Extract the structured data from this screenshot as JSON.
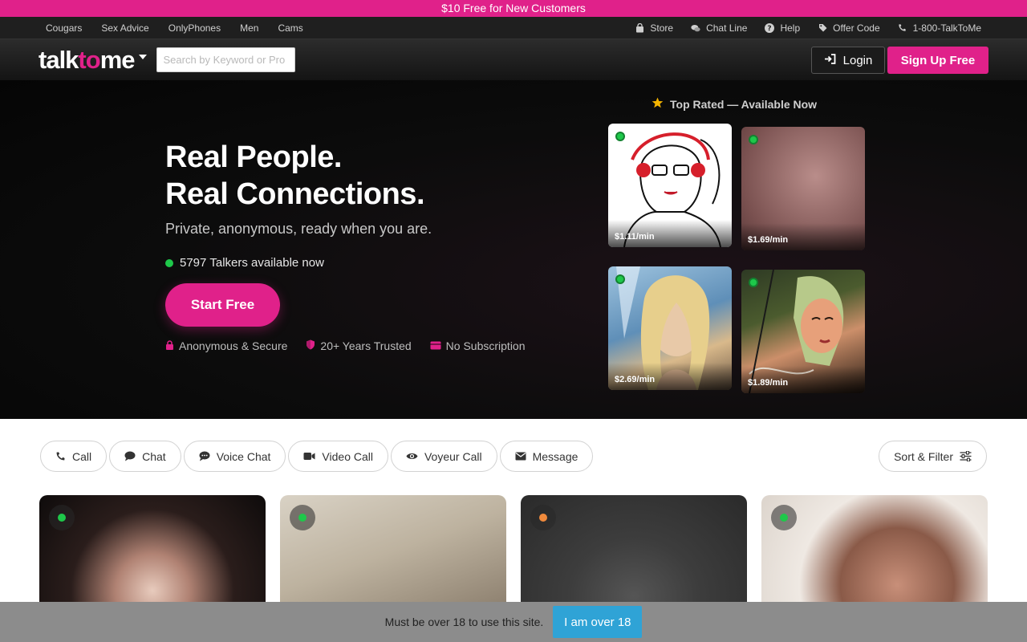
{
  "promo": {
    "text": "$10 Free for New Customers"
  },
  "utility_nav": {
    "left": [
      "Cougars",
      "Sex Advice",
      "OnlyPhones",
      "Men",
      "Cams"
    ],
    "right": [
      {
        "label": "Store",
        "icon": "bag-icon"
      },
      {
        "label": "Chat Line",
        "icon": "chat-bubbles-icon"
      },
      {
        "label": "Help",
        "icon": "question-circle-icon"
      },
      {
        "label": "Offer Code",
        "icon": "tag-icon"
      },
      {
        "label": "1-800-TalkToMe",
        "icon": "phone-icon"
      }
    ]
  },
  "header": {
    "logo_part1": "talk",
    "logo_part2": "to",
    "logo_part3": "me",
    "search_placeholder": "Search by Keyword or Pro",
    "login_label": "Login",
    "signup_label": "Sign Up Free"
  },
  "hero": {
    "headline_line1": "Real People.",
    "headline_line2": "Real Connections.",
    "subheading": "Private, anonymous, ready when you are.",
    "online_count": "5797",
    "online_suffix": "Talkers available now",
    "cta_label": "Start Free",
    "trust": [
      "Anonymous & Secure",
      "20+ Years Trusted",
      "No Subscription"
    ]
  },
  "top_rated": {
    "title": "Top Rated — Available Now",
    "tiles": [
      {
        "price": "$1.11/min",
        "status": "online"
      },
      {
        "price": "$1.69/min",
        "status": "online"
      },
      {
        "price": "$2.69/min",
        "status": "online"
      },
      {
        "price": "$1.89/min",
        "status": "online"
      }
    ]
  },
  "filters": {
    "chips": [
      {
        "label": "Call",
        "icon": "phone-icon"
      },
      {
        "label": "Chat",
        "icon": "chat-bubble-icon"
      },
      {
        "label": "Voice Chat",
        "icon": "voice-chat-icon"
      },
      {
        "label": "Video Call",
        "icon": "video-camera-icon"
      },
      {
        "label": "Voyeur Call",
        "icon": "eye-icon"
      },
      {
        "label": "Message",
        "icon": "envelope-icon"
      }
    ],
    "sort_label": "Sort & Filter"
  },
  "cards": [
    {
      "status_color": "#1ec84a"
    },
    {
      "status_color": "#1ec84a"
    },
    {
      "status_color": "#f08a3c"
    },
    {
      "status_color": "#1ec84a"
    }
  ],
  "age_notice": {
    "text": "Must be over 18 to use this site.",
    "button_label": "I am over 18"
  },
  "colors": {
    "brand_pink": "#e0218a",
    "online_green": "#1ec84a",
    "away_orange": "#f08a3c",
    "confirm_blue": "#2fa3d6"
  }
}
